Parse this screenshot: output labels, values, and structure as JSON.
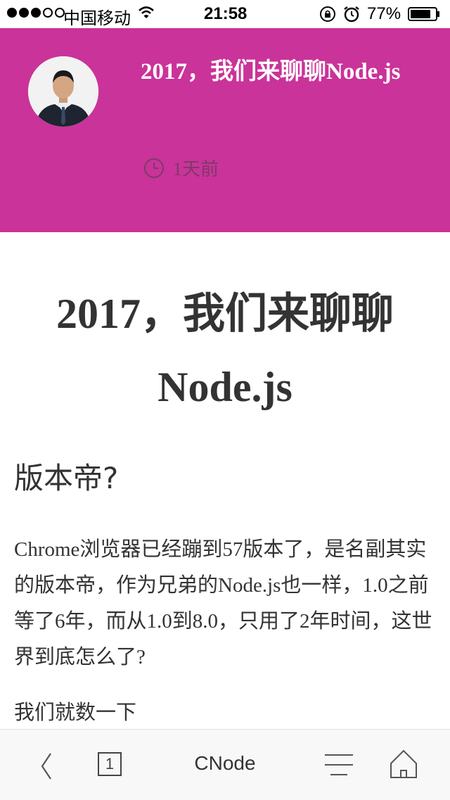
{
  "status_bar": {
    "carrier": "中国移动",
    "time": "21:58",
    "battery": "77%"
  },
  "hero": {
    "background_color": "#ca3399",
    "title": "2017，我们来聊聊Node.js",
    "time_ago": "1天前"
  },
  "article": {
    "title": "2017，我们来聊聊Node.js",
    "section_heading": "版本帝?",
    "paragraph_1": "Chrome浏览器已经蹦到57版本了，是名副其实的版本帝，作为兄弟的Node.js也一样，1.0之前等了6年，而从1.0到8.0，只用了2年时间，这世界到底怎么了?",
    "paragraph_2": "我们就数一下"
  },
  "toolbar": {
    "back_icon": "chevron-left-icon",
    "tab_count": "1",
    "title": "CNode",
    "menu_icon": "menu-icon",
    "home_icon": "home-icon"
  }
}
